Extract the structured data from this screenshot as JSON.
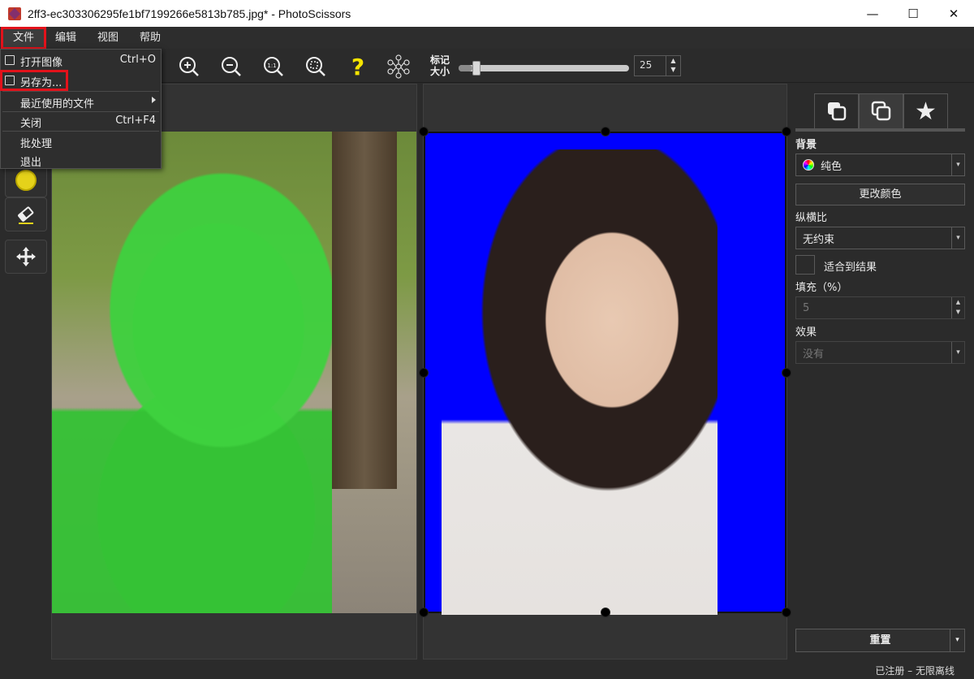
{
  "window": {
    "title": "2ff3-ec303306295fe1bf7199266e5813b785.jpg* - PhotoScissors",
    "minimize": "—",
    "maximize": "☐",
    "close": "✕"
  },
  "menubar": {
    "items": [
      {
        "label": "文件"
      },
      {
        "label": "编辑"
      },
      {
        "label": "视图"
      },
      {
        "label": "帮助"
      }
    ]
  },
  "file_menu": {
    "items": [
      {
        "label": "打开图像",
        "shortcut": "Ctrl+O"
      },
      {
        "label": "另存为...",
        "shortcut": ""
      },
      {
        "label": "最近使用的文件",
        "shortcut": ""
      },
      {
        "label": "关闭",
        "shortcut": "Ctrl+F4"
      },
      {
        "label": "批处理",
        "shortcut": ""
      },
      {
        "label": "退出",
        "shortcut": ""
      }
    ]
  },
  "toolbar": {
    "marker_label_line1": "标记",
    "marker_label_line2": "大小",
    "marker_size": "25",
    "marker_size_fraction": 0.08,
    "zoom_in": "zoom-in-icon",
    "zoom_out": "zoom-out-icon",
    "actual_size": "1:1",
    "fit": "fit-icon",
    "help": "?",
    "network": "network-icon"
  },
  "right_panel": {
    "background_label": "背景",
    "background_value": "纯色",
    "change_color_button": "更改颜色",
    "aspect_label": "纵横比",
    "aspect_value": "无约束",
    "fit_to_result_label": "适合到结果",
    "padding_label": "填充（%）",
    "padding_value": "5",
    "effect_label": "效果",
    "effect_value": "没有",
    "reset_button": "重置"
  },
  "statusbar": {
    "text": "已注册 – 无限离线"
  },
  "colors": {
    "accent_red": "#e2121b",
    "mask_green": "#3fd13f",
    "background_blue": "#0000ff",
    "marker_yellow": "#e5d21a"
  }
}
